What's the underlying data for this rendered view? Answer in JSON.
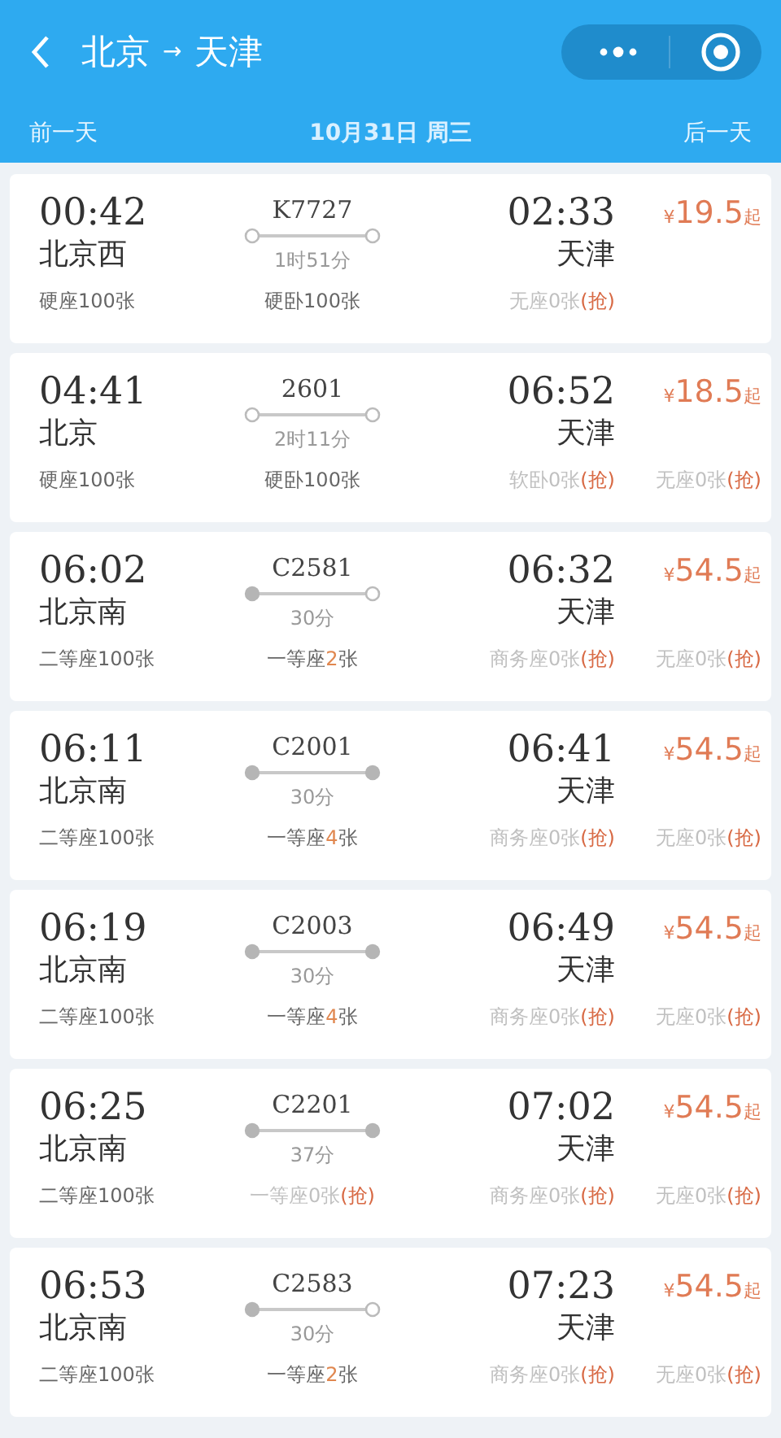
{
  "header": {
    "title_from": "北京",
    "title_arrow": "→",
    "title_to": "天津"
  },
  "date_bar": {
    "prev": "前一天",
    "date": "10月31日 周三",
    "next": "后一天"
  },
  "trains": [
    {
      "dep_time": "00:42",
      "dep_station": "北京西",
      "number": "K7727",
      "duration": "1时51分",
      "starts_here": true,
      "ends_here": true,
      "arr_time": "02:33",
      "arr_station": "天津",
      "currency": "¥",
      "price": "19.5",
      "price_suffix": "起",
      "seats": [
        {
          "kind": "plenty",
          "name": "硬座",
          "count": "100",
          "unit": "张"
        },
        {
          "kind": "plenty",
          "name": "硬卧",
          "count": "100",
          "unit": "张"
        },
        {
          "kind": "soldout",
          "name": "无座",
          "count": "0",
          "unit": "张",
          "grab": "(抢)"
        }
      ]
    },
    {
      "dep_time": "04:41",
      "dep_station": "北京",
      "number": "2601",
      "duration": "2时11分",
      "starts_here": true,
      "ends_here": true,
      "arr_time": "06:52",
      "arr_station": "天津",
      "currency": "¥",
      "price": "18.5",
      "price_suffix": "起",
      "seats": [
        {
          "kind": "plenty",
          "name": "硬座",
          "count": "100",
          "unit": "张"
        },
        {
          "kind": "plenty",
          "name": "硬卧",
          "count": "100",
          "unit": "张"
        },
        {
          "kind": "soldout",
          "name": "软卧",
          "count": "0",
          "unit": "张",
          "grab": "(抢)"
        },
        {
          "kind": "soldout",
          "name": "无座",
          "count": "0",
          "unit": "张",
          "grab": "(抢)"
        }
      ]
    },
    {
      "dep_time": "06:02",
      "dep_station": "北京南",
      "number": "C2581",
      "duration": "30分",
      "starts_here": false,
      "ends_here": true,
      "arr_time": "06:32",
      "arr_station": "天津",
      "currency": "¥",
      "price": "54.5",
      "price_suffix": "起",
      "seats": [
        {
          "kind": "plenty",
          "name": "二等座",
          "count": "100",
          "unit": "张"
        },
        {
          "kind": "few",
          "name": "一等座",
          "count": "2",
          "unit": "张"
        },
        {
          "kind": "soldout",
          "name": "商务座",
          "count": "0",
          "unit": "张",
          "grab": "(抢)"
        },
        {
          "kind": "soldout",
          "name": "无座",
          "count": "0",
          "unit": "张",
          "grab": "(抢)"
        }
      ]
    },
    {
      "dep_time": "06:11",
      "dep_station": "北京南",
      "number": "C2001",
      "duration": "30分",
      "starts_here": false,
      "ends_here": false,
      "arr_time": "06:41",
      "arr_station": "天津",
      "currency": "¥",
      "price": "54.5",
      "price_suffix": "起",
      "seats": [
        {
          "kind": "plenty",
          "name": "二等座",
          "count": "100",
          "unit": "张"
        },
        {
          "kind": "few",
          "name": "一等座",
          "count": "4",
          "unit": "张"
        },
        {
          "kind": "soldout",
          "name": "商务座",
          "count": "0",
          "unit": "张",
          "grab": "(抢)"
        },
        {
          "kind": "soldout",
          "name": "无座",
          "count": "0",
          "unit": "张",
          "grab": "(抢)"
        }
      ]
    },
    {
      "dep_time": "06:19",
      "dep_station": "北京南",
      "number": "C2003",
      "duration": "30分",
      "starts_here": false,
      "ends_here": false,
      "arr_time": "06:49",
      "arr_station": "天津",
      "currency": "¥",
      "price": "54.5",
      "price_suffix": "起",
      "seats": [
        {
          "kind": "plenty",
          "name": "二等座",
          "count": "100",
          "unit": "张"
        },
        {
          "kind": "few",
          "name": "一等座",
          "count": "4",
          "unit": "张"
        },
        {
          "kind": "soldout",
          "name": "商务座",
          "count": "0",
          "unit": "张",
          "grab": "(抢)"
        },
        {
          "kind": "soldout",
          "name": "无座",
          "count": "0",
          "unit": "张",
          "grab": "(抢)"
        }
      ]
    },
    {
      "dep_time": "06:25",
      "dep_station": "北京南",
      "number": "C2201",
      "duration": "37分",
      "starts_here": false,
      "ends_here": false,
      "arr_time": "07:02",
      "arr_station": "天津",
      "currency": "¥",
      "price": "54.5",
      "price_suffix": "起",
      "seats": [
        {
          "kind": "plenty",
          "name": "二等座",
          "count": "100",
          "unit": "张"
        },
        {
          "kind": "soldout",
          "name": "一等座",
          "count": "0",
          "unit": "张",
          "grab": "(抢)"
        },
        {
          "kind": "soldout",
          "name": "商务座",
          "count": "0",
          "unit": "张",
          "grab": "(抢)"
        },
        {
          "kind": "soldout",
          "name": "无座",
          "count": "0",
          "unit": "张",
          "grab": "(抢)"
        }
      ]
    },
    {
      "dep_time": "06:53",
      "dep_station": "北京南",
      "number": "C2583",
      "duration": "30分",
      "starts_here": false,
      "ends_here": true,
      "arr_time": "07:23",
      "arr_station": "天津",
      "currency": "¥",
      "price": "54.5",
      "price_suffix": "起",
      "seats": [
        {
          "kind": "plenty",
          "name": "二等座",
          "count": "100",
          "unit": "张"
        },
        {
          "kind": "few",
          "name": "一等座",
          "count": "2",
          "unit": "张"
        },
        {
          "kind": "soldout",
          "name": "商务座",
          "count": "0",
          "unit": "张",
          "grab": "(抢)"
        },
        {
          "kind": "soldout",
          "name": "无座",
          "count": "0",
          "unit": "张",
          "grab": "(抢)"
        }
      ]
    }
  ]
}
